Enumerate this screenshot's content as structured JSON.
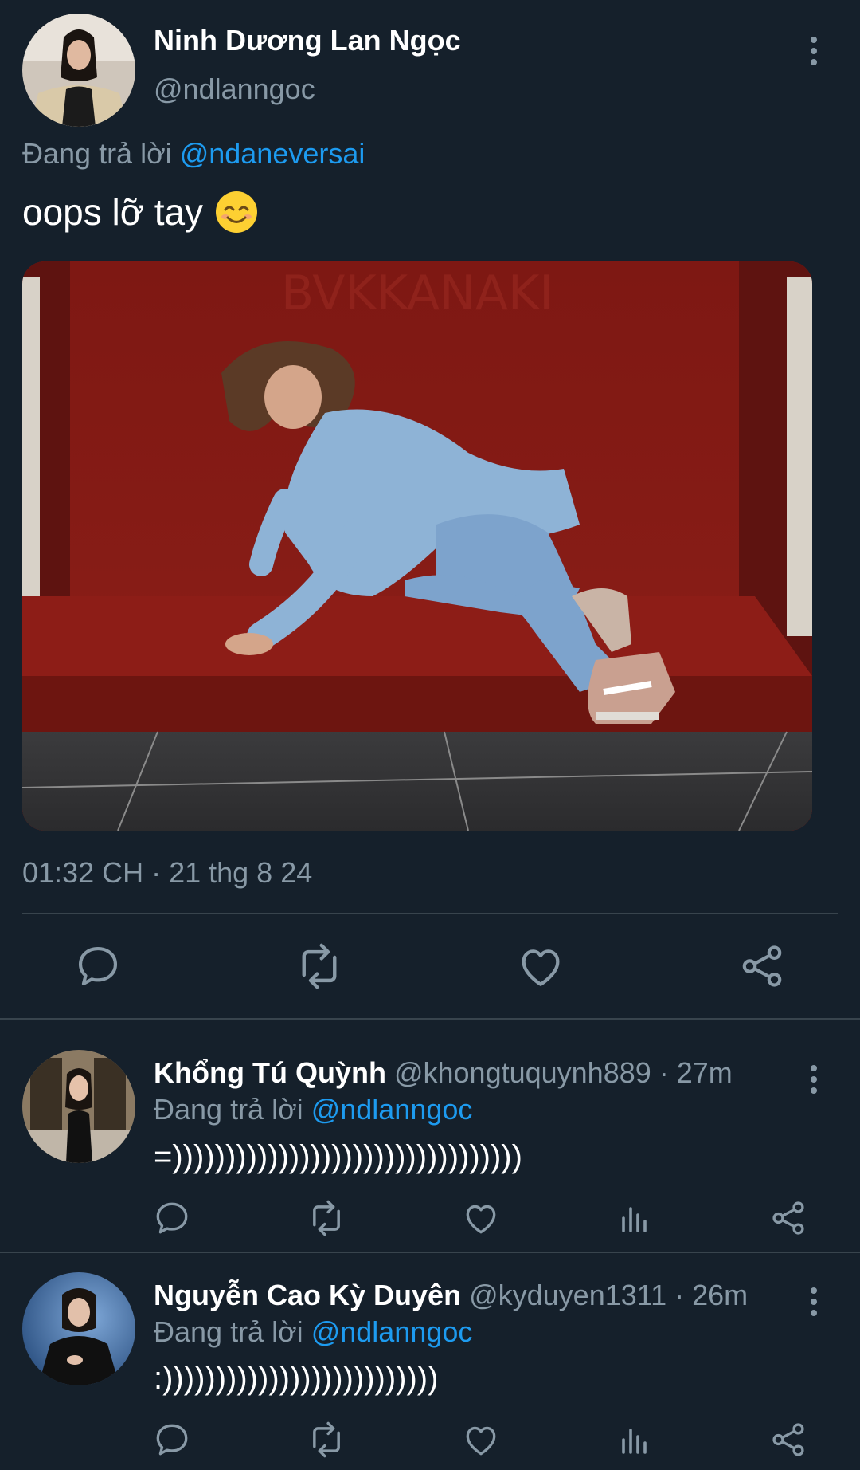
{
  "main_tweet": {
    "author_name": "Ninh Dương Lan Ngọc",
    "author_handle": "@ndlanngoc",
    "reply_prefix": "Đang trả lời ",
    "reply_to": "@ndaneversai",
    "text": "oops lỡ tay",
    "emoji": "smiling-face-emoji",
    "timestamp": "01:32 CH · 21 thg 8 24",
    "actions": [
      "reply-icon",
      "retweet-icon",
      "like-icon",
      "share-icon"
    ]
  },
  "replies": [
    {
      "name": "Khổng Tú Quỳnh",
      "handle": "@khongtuquynh889",
      "time": " · 27m",
      "reply_prefix": "Đang trả lời ",
      "reply_to": "@ndlanngoc",
      "text": "=)))))))))))))))))))))))))))))))))"
    },
    {
      "name": "Nguyễn Cao Kỳ Duyên",
      "handle": "@kyduyen1311",
      "time": " · 26m",
      "reply_prefix": "Đang trả lời ",
      "reply_to": "@ndlanngoc",
      "text": ":))))))))))))))))))))))))))"
    }
  ],
  "colors": {
    "background": "#15202b",
    "secondary_text": "#8899a6",
    "link": "#1d9bf0",
    "divider": "#38444d"
  }
}
